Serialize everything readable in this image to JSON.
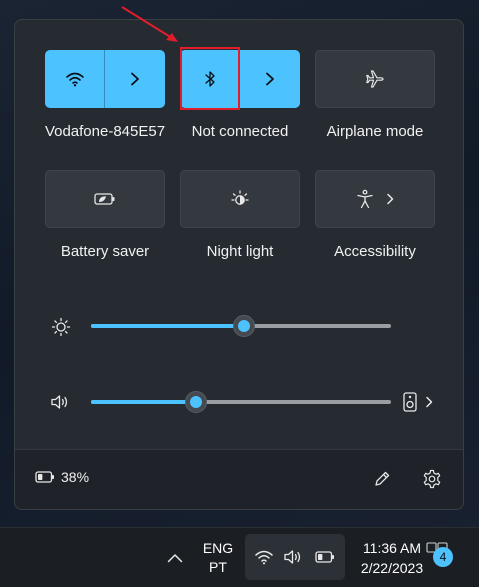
{
  "quick_settings": {
    "wifi": {
      "label": "Vodafone-845E57",
      "icon": "wifi-icon",
      "active": true
    },
    "bluetooth": {
      "label": "Not connected",
      "icon": "bluetooth-icon",
      "active": true
    },
    "airplane": {
      "label": "Airplane mode",
      "icon": "airplane-icon",
      "active": false
    },
    "battery_saver": {
      "label": "Battery saver",
      "icon": "battery-saver-icon",
      "active": false
    },
    "night_light": {
      "label": "Night light",
      "icon": "night-light-icon",
      "active": false
    },
    "accessibility": {
      "label": "Accessibility",
      "icon": "accessibility-icon",
      "active": false
    }
  },
  "sliders": {
    "brightness": {
      "icon": "brightness-icon",
      "value_percent": 51
    },
    "volume": {
      "icon": "speaker-icon",
      "value_percent": 35,
      "output_icon": "speaker-device-icon"
    }
  },
  "footer": {
    "battery_text": "38%",
    "battery_level_percent": 38
  },
  "taskbar": {
    "language_line1": "ENG",
    "language_line2": "PT",
    "time": "11:36 AM",
    "date": "2/22/2023",
    "notification_count": "4"
  },
  "colors": {
    "accent": "#4cc2ff",
    "panel": "#262b32",
    "highlight": "#e11d2b",
    "annotation_arrow": "#e11d2b"
  }
}
